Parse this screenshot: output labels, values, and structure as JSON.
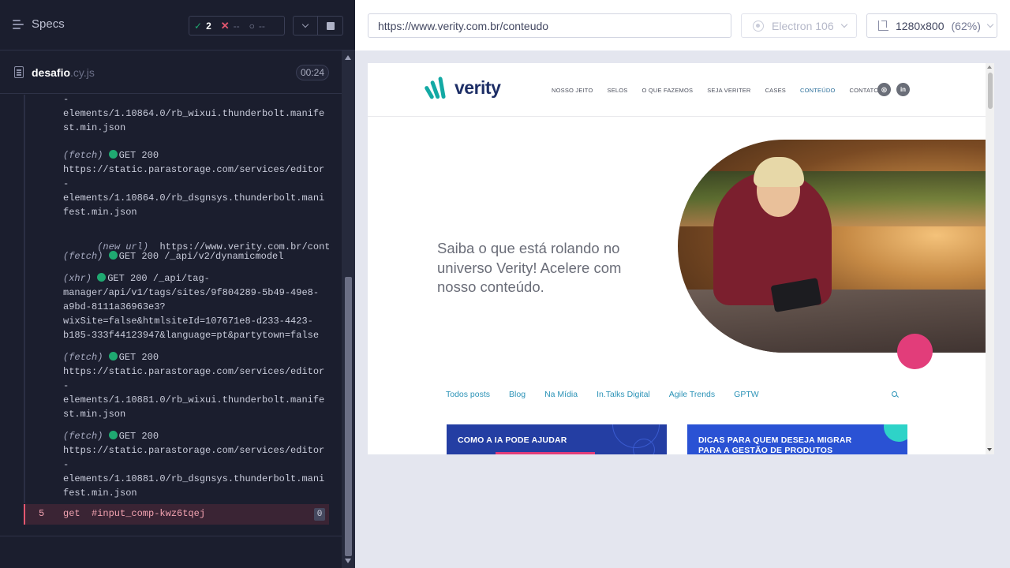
{
  "runner": {
    "specs_label": "Specs",
    "stats": {
      "passed": "2",
      "failed": "--",
      "pending": "--"
    },
    "spec": {
      "name": "desafio",
      "ext": ".cy.js",
      "duration": "00:24"
    },
    "log": [
      {
        "lines": [
          "-",
          "elements/1.10864.0/rb_wixui.thunderbolt.manife",
          "st.min.json"
        ]
      },
      {
        "cmd": "(fetch)",
        "status": "GET 200",
        "lines": [
          "https://static.parastorage.com/services/editor",
          "-",
          "elements/1.10864.0/rb_dsgnsys.thunderbolt.mani",
          "fest.min.json"
        ]
      },
      {
        "cmd": "(new url)",
        "text": "https://www.verity.com.br/conteudo"
      },
      {
        "cmd": "(fetch)",
        "status": "GET 200 /_api/v2/dynamicmodel"
      },
      {
        "cmd": "(xhr)",
        "status": "GET 200 /_api/tag-",
        "lines": [
          "manager/api/v1/tags/sites/9f804289-5b49-49e8-",
          "a9bd-8111a36963e3?",
          "wixSite=false&htmlsiteId=107671e8-d233-4423-",
          "b185-333f44123947&language=pt&partytown=false"
        ]
      },
      {
        "cmd": "(fetch)",
        "status": "GET 200",
        "lines": [
          "https://static.parastorage.com/services/editor",
          "-",
          "elements/1.10881.0/rb_wixui.thunderbolt.manife",
          "st.min.json"
        ]
      },
      {
        "cmd": "(fetch)",
        "status": "GET 200",
        "lines": [
          "https://static.parastorage.com/services/editor",
          "-",
          "elements/1.10881.0/rb_dsgnsys.thunderbolt.mani",
          "fest.min.json"
        ]
      }
    ],
    "failed_command": {
      "index": "5",
      "name": "get",
      "selector": "#input_comp-kwz6tqej",
      "count": "0"
    }
  },
  "aut": {
    "url": "https://www.verity.com.br/conteudo",
    "browser": "Electron 106",
    "viewport": "1280x800",
    "scale": "(62%)"
  },
  "site": {
    "logo": "verity",
    "nav": [
      "NOSSO JEITO",
      "SELOS",
      "O QUE FAZEMOS",
      "SEJA VERITER",
      "CASES",
      "CONTEÚDO",
      "CONTATO"
    ],
    "hero_text": "Saiba o que está rolando no universo Verity! Acelere com nosso conteúdo.",
    "tabs": [
      "Todos posts",
      "Blog",
      "Na Mídia",
      "In.Talks Digital",
      "Agile Trends",
      "GPTW"
    ],
    "cards": [
      {
        "title_1": "COMO A IA PODE AJUDAR"
      },
      {
        "title_1": "DICAS PARA QUEM DESEJA MIGRAR",
        "title_2": "PARA A GESTÃO DE PRODUTOS"
      }
    ]
  },
  "colors": {
    "runner_bg": "#1b1e2e",
    "pass": "#1fa971",
    "fail": "#e45770",
    "brand_teal": "#13a9a4",
    "brand_navy": "#1d2e66",
    "accent_pink": "#e23d7a"
  }
}
